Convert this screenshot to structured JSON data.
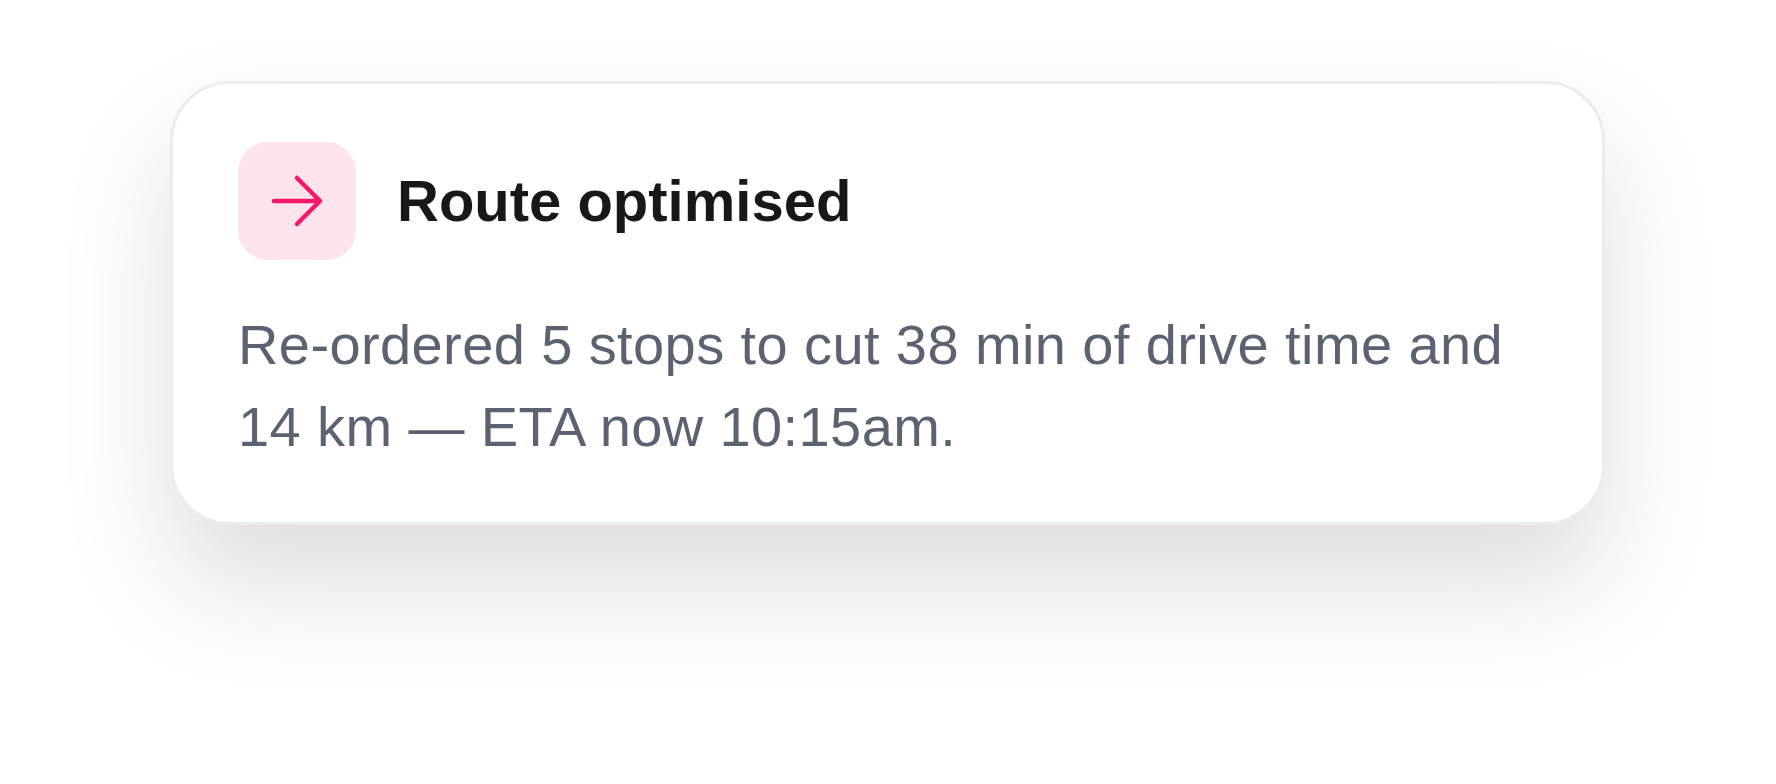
{
  "notification": {
    "title": "Route optimised",
    "message": "Re-ordered 5 stops to cut 38 min of drive time and 14 km — ETA now 10:15am."
  }
}
